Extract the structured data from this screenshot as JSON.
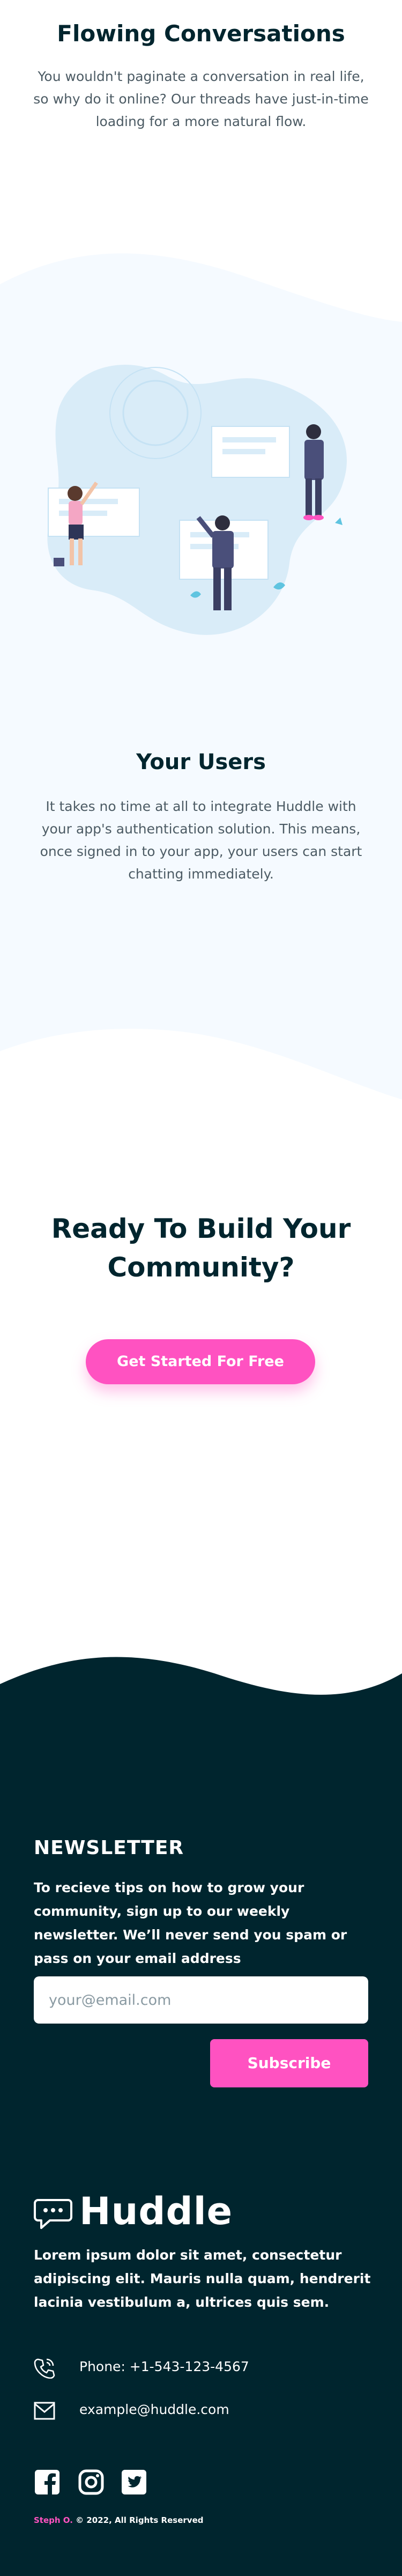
{
  "flowing": {
    "title": "Flowing Conversations",
    "text": "You wouldn't paginate a conversation in real life, so why do it online? Our threads have just-in-time loading for a more natural flow."
  },
  "users": {
    "title": "Your Users",
    "text": "It takes no time at all to integrate Huddle with your app's authentication solution. This means, once signed in to your app, your users can start chatting immediately."
  },
  "cta": {
    "title": "Ready To Build Your Community?",
    "button_label": "Get Started For Free"
  },
  "newsletter": {
    "title": "NEWSLETTER",
    "text": "To recieve tips on how to grow your community, sign up to our weekly newsletter. We’ll never send you spam or pass on your email address",
    "email_placeholder": "your@email.com",
    "email_value": "",
    "subscribe_label": "Subscribe"
  },
  "footer": {
    "logo_text": "Huddle",
    "text": "Lorem ipsum dolor sit amet, consectetur adipiscing elit. Mauris nulla quam, hendrerit lacinia vestibulum a, ultrices quis sem.",
    "phone": "Phone: +1-543-123-4567",
    "email": "example@huddle.com",
    "social": [
      "facebook-icon",
      "instagram-icon",
      "twitter-icon"
    ],
    "copyright_name": "Steph O.",
    "copyright_rest": " © 2022, All Rights Reserved"
  },
  "colors": {
    "accent": "#ff52c1",
    "dark": "#00252e",
    "light_bg": "#f5faff",
    "text_muted": "#4c5b64"
  }
}
